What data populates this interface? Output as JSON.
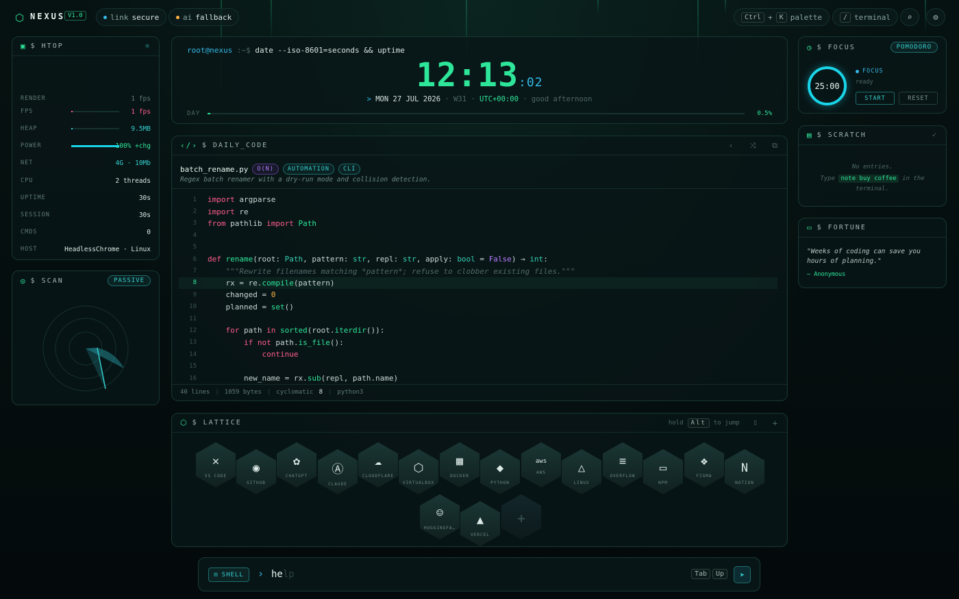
{
  "topbar": {
    "brand": "NEXUS",
    "version": "V1.0",
    "link_label": "link",
    "link_value": "secure",
    "ai_label": "ai",
    "ai_value": "fallback",
    "palette_key1": "Ctrl",
    "palette_plus": "+",
    "palette_key2": "K",
    "palette_label": "palette",
    "terminal_key": "/",
    "terminal_label": "terminal"
  },
  "htop": {
    "title": "$ HTOP",
    "rows": [
      {
        "k": "RENDER",
        "v": "1 fps"
      },
      {
        "k": "FPS",
        "v": "1 fps"
      },
      {
        "k": "HEAP",
        "v": "9.5MB"
      },
      {
        "k": "POWER",
        "v": "100% +chg"
      },
      {
        "k": "NET",
        "v": "4G · 10Mb"
      },
      {
        "k": "CPU",
        "v": "2 threads"
      },
      {
        "k": "UPTIME",
        "v": "30s"
      },
      {
        "k": "SESSION",
        "v": "30s"
      },
      {
        "k": "CMDS",
        "v": "0"
      },
      {
        "k": "HOST",
        "v": "HeadlessChrome · Linux"
      }
    ],
    "power_level": 1.0
  },
  "scan": {
    "title": "$ SCAN",
    "badge": "PASSIVE"
  },
  "clock": {
    "user": "root@nexus",
    "path": ":~$",
    "command": "date --iso-8601=seconds && uptime",
    "time": "12:13",
    "seconds": ":02",
    "prefix": ">",
    "date": "MON 27 JUL 2026",
    "week": "W31",
    "tz": "UTC+00:00",
    "greeting": "good afternoon",
    "sep": "·",
    "day_label": "DAY",
    "day_pct": "0.5%",
    "day_fraction": 0.005
  },
  "daily": {
    "title": "$ DAILY_CODE",
    "filename": "batch_rename.py",
    "tags": [
      "O(N)",
      "AUTOMATION",
      "CLI"
    ],
    "description": "Regex batch renamer with a dry-run mode and collision detection.",
    "lines": [
      "1",
      "2",
      "3",
      "4",
      "5",
      "6",
      "7",
      "8",
      "9",
      "10",
      "11",
      "12",
      "13",
      "14",
      "15",
      "16"
    ],
    "footer": {
      "lines": "40 lines",
      "bytes": "1059 bytes",
      "cyclo_label": "cyclomatic",
      "cyclo": "8",
      "lang": "python3"
    }
  },
  "lattice": {
    "title": "$ LATTICE",
    "hint_pre": "hold",
    "hint_key": "Alt",
    "hint_post": "to jump",
    "add": "+",
    "items": [
      {
        "label": "VS CODE",
        "icon": "✕"
      },
      {
        "label": "GITHUB",
        "icon": "◉"
      },
      {
        "label": "CHATGPT",
        "icon": "✿"
      },
      {
        "label": "CLAUDE",
        "icon": "Ⓐ"
      },
      {
        "label": "CLOUDFLARE",
        "icon": "☁"
      },
      {
        "label": "VIRTUALBOX",
        "icon": "⬡"
      },
      {
        "label": "DOCKER",
        "icon": "▦"
      },
      {
        "label": "PYTHON",
        "icon": "◆"
      },
      {
        "label": "AWS",
        "icon": "aws"
      },
      {
        "label": "LINUX",
        "icon": "△"
      },
      {
        "label": "OVERFLOW",
        "icon": "≡"
      },
      {
        "label": "NPM",
        "icon": "▭"
      },
      {
        "label": "FIGMA",
        "icon": "❖"
      },
      {
        "label": "NOTION",
        "icon": "N"
      },
      {
        "label": "HUGGINGFA…",
        "icon": "☺"
      },
      {
        "label": "VERCEL",
        "icon": "▲"
      }
    ]
  },
  "focus": {
    "title": "$ FOCUS",
    "badge": "POMODORO",
    "time": "25:00",
    "state_label": "FOCUS",
    "state": "ready",
    "start": "START",
    "reset": "RESET"
  },
  "scratch": {
    "title": "$ SCRATCH",
    "empty": "No entries.",
    "hint_pre": "Type",
    "hint_cmd": "note buy coffee",
    "hint_post": "in the terminal."
  },
  "fortune": {
    "title": "$ FORTUNE",
    "quote": "\"Weeks of coding can save you hours of planning.\"",
    "author": "— Anonymous"
  },
  "shell": {
    "mode": "SHELL",
    "typed": "he",
    "ghost": "lp",
    "key_tab": "Tab",
    "key_up": "Up"
  },
  "colors": {
    "accent": "#2ee69a",
    "cyan": "#35b8e6",
    "pink": "#ff5c8d",
    "bg": "#050d0e"
  }
}
